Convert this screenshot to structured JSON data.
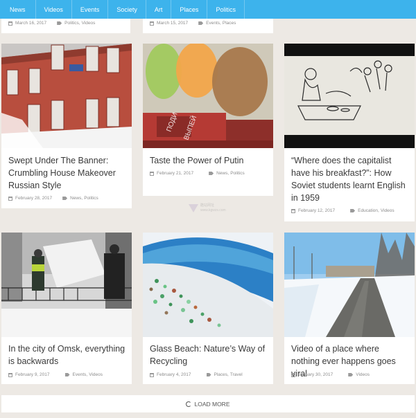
{
  "nav": {
    "items": [
      "News",
      "Videos",
      "Events",
      "Society",
      "Art",
      "Places",
      "Politics"
    ]
  },
  "partial_cards": [
    {
      "date": "March 16, 2017",
      "tags": [
        "Politics",
        "Videos"
      ]
    },
    {
      "date": "March 15, 2017",
      "tags": [
        "Events",
        "Places"
      ]
    }
  ],
  "cards": [
    {
      "title": "Swept Under The Banner: Crumbling House Makeover Russian Style",
      "date": "February 28, 2017",
      "tags": [
        "News",
        "Politics"
      ],
      "image": "red-brick-building-photo"
    },
    {
      "title": "Taste the Power of Putin",
      "date": "February 21, 2017",
      "tags": [
        "News",
        "Politics"
      ],
      "image": "putin-lollipops-photo"
    },
    {
      "title": "“Where does the capitalist have his breakfast?”: How Soviet students learnt English in 1959",
      "date": "February 12, 2017",
      "tags": [
        "Education",
        "Videos"
      ],
      "image": "soviet-cartoon-sketch"
    },
    {
      "title": "In the city of Omsk, everything is backwards",
      "date": "February 9, 2017",
      "tags": [
        "Events",
        "Videos"
      ],
      "image": "omsk-snow-workers-photo"
    },
    {
      "title": "Glass Beach: Nature’s Way of Recycling",
      "date": "February 4, 2017",
      "tags": [
        "Places",
        "Travel"
      ],
      "image": "glass-beach-photo"
    },
    {
      "title": "Video of a place where nothing ever happens goes viral",
      "date": "January 30, 2017",
      "tags": [
        "Videos"
      ],
      "image": "snowy-road-photo"
    }
  ],
  "load_more": "LOAD MORE",
  "watermark": {
    "line1": "酷站网址",
    "line2": "www.kgwzs.com"
  },
  "colors": {
    "nav_bg": "#3db3ec",
    "page_bg": "#ede9e4",
    "card_bg": "#ffffff",
    "title": "#3a3a3a",
    "meta": "#8c8c8c"
  }
}
